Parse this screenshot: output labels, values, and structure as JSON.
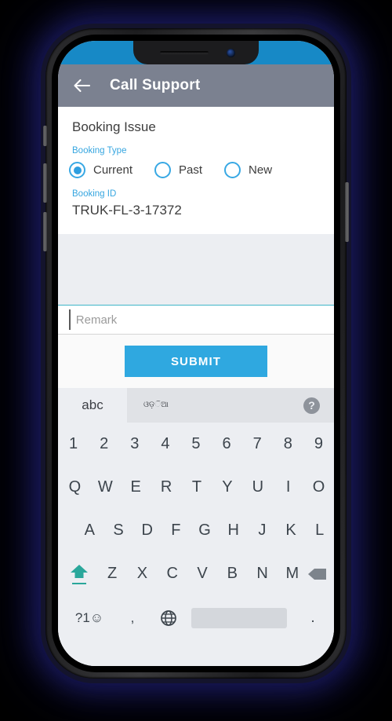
{
  "app": {
    "title": "Call Support",
    "back_icon": "back-arrow-icon"
  },
  "form": {
    "section_title": "Booking Issue",
    "booking_type_label": "Booking Type",
    "booking_type_options": [
      {
        "label": "Current",
        "selected": true
      },
      {
        "label": "Past",
        "selected": false
      },
      {
        "label": "New",
        "selected": false
      }
    ],
    "booking_id_label": "Booking ID",
    "booking_id_value": "TRUK-FL-3-17372",
    "remark_placeholder": "Remark",
    "remark_value": "",
    "submit_label": "SUBMIT"
  },
  "keyboard": {
    "tab_latin": "abc",
    "tab_script": "ଓଡ଼ିଆ",
    "tab_script_line1": "ଓଡ଼",
    "tab_script_line2": "ିଆ",
    "help_icon": "help-icon",
    "row_numbers": [
      "1",
      "2",
      "3",
      "4",
      "5",
      "6",
      "7",
      "8",
      "9"
    ],
    "row_top": [
      "Q",
      "W",
      "E",
      "R",
      "T",
      "Y",
      "U",
      "I",
      "O"
    ],
    "row_home": [
      "A",
      "S",
      "D",
      "F",
      "G",
      "H",
      "J",
      "K",
      "L"
    ],
    "row_bottom": [
      "Z",
      "X",
      "C",
      "V",
      "B",
      "N",
      "M"
    ],
    "shift_icon": "shift-caps-icon",
    "backspace_icon": "backspace-icon",
    "symbols_key": "?1☺",
    "comma_key": ",",
    "globe_icon": "globe-language-icon",
    "space_key": "",
    "period_key": "."
  },
  "device": {
    "speaker_icon": "earpiece-speaker",
    "camera_icon": "front-camera",
    "mute_switch": "silent-switch",
    "volume_up": "volume-up-button",
    "volume_down": "volume-down-button",
    "power": "power-button"
  },
  "colors": {
    "accent_blue": "#2fa8e0",
    "appbar_gray": "#7b8190",
    "status_blue": "#1789c6",
    "shift_teal": "#2aa79b",
    "keyboard_bg": "#eceef2"
  }
}
